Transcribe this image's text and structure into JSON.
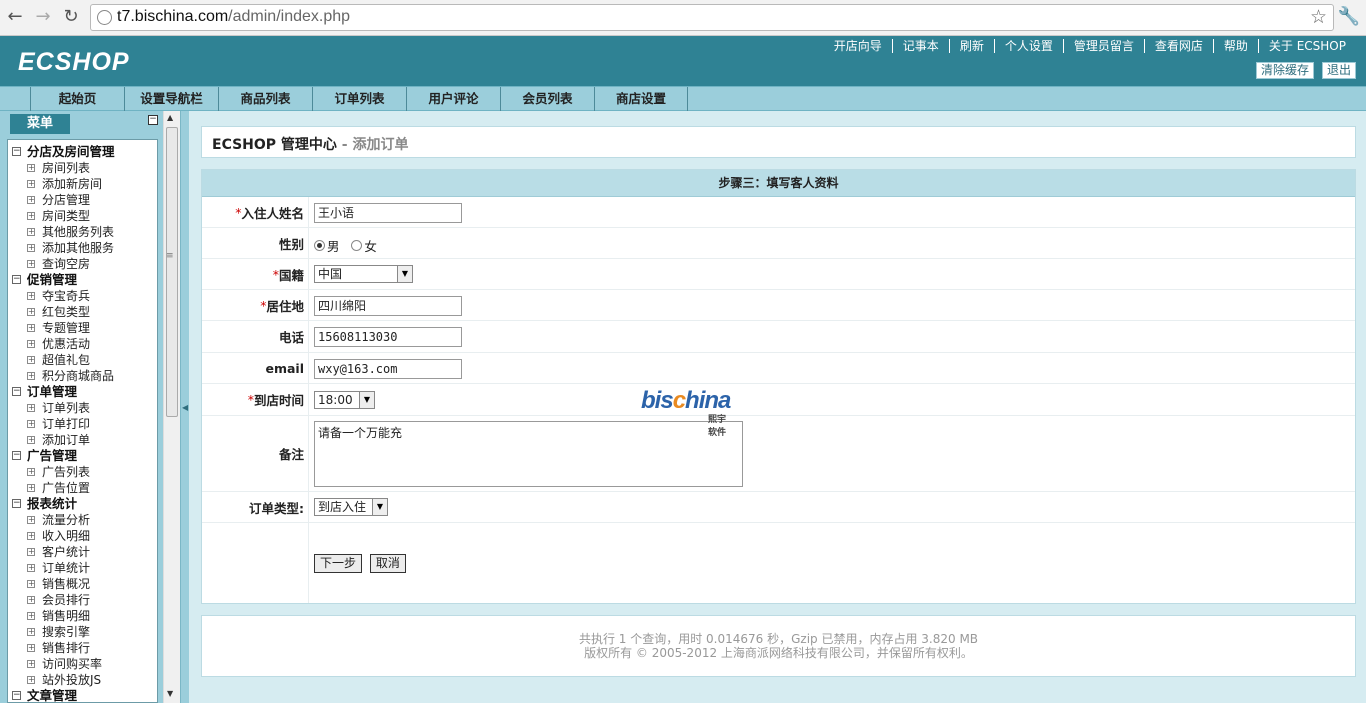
{
  "browser": {
    "url_host": "t7.bischina.com",
    "url_path": "/admin/index.php"
  },
  "header": {
    "logo": "ECSHOP",
    "top_links": [
      "开店向导",
      "记事本",
      "刷新",
      "个人设置",
      "管理员留言",
      "查看网店",
      "帮助",
      "关于 ECSHOP"
    ],
    "clear_cache_label": "清除缓存",
    "logout_label": "退出"
  },
  "nav": {
    "tabs": [
      "起始页",
      "设置导航栏",
      "商品列表",
      "订单列表",
      "用户评论",
      "会员列表",
      "商店设置"
    ]
  },
  "sidebar": {
    "title": "菜单",
    "groups": [
      {
        "label": "分店及房间管理",
        "items": [
          "房间列表",
          "添加新房间",
          "分店管理",
          "房间类型",
          "其他服务列表",
          "添加其他服务",
          "查询空房"
        ]
      },
      {
        "label": "促销管理",
        "items": [
          "夺宝奇兵",
          "红包类型",
          "专题管理",
          "优惠活动",
          "超值礼包",
          "积分商城商品"
        ]
      },
      {
        "label": "订单管理",
        "items": [
          "订单列表",
          "订单打印",
          "添加订单"
        ]
      },
      {
        "label": "广告管理",
        "items": [
          "广告列表",
          "广告位置"
        ]
      },
      {
        "label": "报表统计",
        "items": [
          "流量分析",
          "收入明细",
          "客户统计",
          "订单统计",
          "销售概况",
          "会员排行",
          "销售明细",
          "搜索引擎",
          "销售排行",
          "访问购买率",
          "站外投放JS"
        ]
      },
      {
        "label": "文章管理",
        "items": []
      }
    ]
  },
  "page": {
    "title": "ECSHOP 管理中心",
    "subtitle": " - 添加订单"
  },
  "form": {
    "step_title": "步骤三：填写客人资料",
    "name_label": "入住人姓名",
    "name_value": "王小语",
    "gender_label": "性别",
    "gender_male": "男",
    "gender_female": "女",
    "nationality_label": "国籍",
    "nationality_value": "中国",
    "residence_label": "居住地",
    "residence_value": "四川绵阳",
    "phone_label": "电话",
    "phone_value": "15608113030",
    "email_label": "email",
    "email_value": "wxy@163.com",
    "arrival_label": "到店时间",
    "arrival_value": "18:00",
    "remark_label": "备注",
    "remark_value": "请备一个万能充",
    "order_type_label": "订单类型:",
    "order_type_value": "到店入住",
    "next_button": "下一步",
    "cancel_button": "取消",
    "required_mark": "*"
  },
  "watermark": {
    "text_a": "bis",
    "text_c": "c",
    "text_b": "hina",
    "sub": "熙宇软件"
  },
  "footer": {
    "line1": "共执行 1 个查询，用时 0.014676 秒，Gzip 已禁用，内存占用 3.820 MB",
    "line2": "版权所有 © 2005-2012 上海商派网络科技有限公司，并保留所有权利。"
  }
}
